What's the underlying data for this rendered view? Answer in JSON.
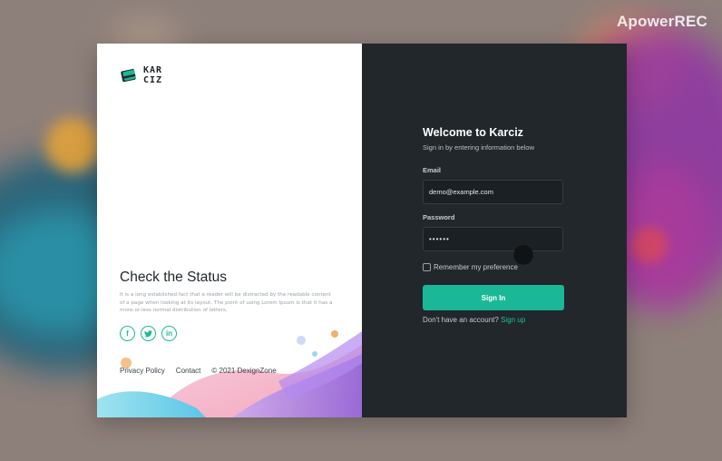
{
  "watermark": "ApowerREC",
  "brand": {
    "logo_line1": "KAR",
    "logo_line2": "CIZ",
    "icon": "card-logo-icon",
    "accent_color": "#1ab896"
  },
  "left_panel": {
    "title": "Check the Status",
    "description": "It is a long established fact that a reader will be distracted by the readable content of a page when looking at its layout. The point of using Lorem Ipsum is that it has a more-or-less normal distribution of letters,",
    "socials": [
      {
        "icon": "facebook-icon",
        "glyph": "f"
      },
      {
        "icon": "twitter-icon",
        "glyph": "t"
      },
      {
        "icon": "linkedin-icon",
        "glyph": "in"
      }
    ],
    "footer": {
      "privacy": "Privacy Policy",
      "contact": "Contact",
      "copyright": "© 2021 DexignZone"
    }
  },
  "login": {
    "heading": "Welcome to Karciz",
    "subheading": "Sign in by entering information below",
    "email_label": "Email",
    "email_value": "demo@example.com",
    "password_label": "Password",
    "password_value": "••••••",
    "remember_label": "Remember my preference",
    "remember_checked": false,
    "signin_label": "Sign In",
    "no_account_text": "Don't have an account?",
    "signup_link": "Sign up"
  }
}
